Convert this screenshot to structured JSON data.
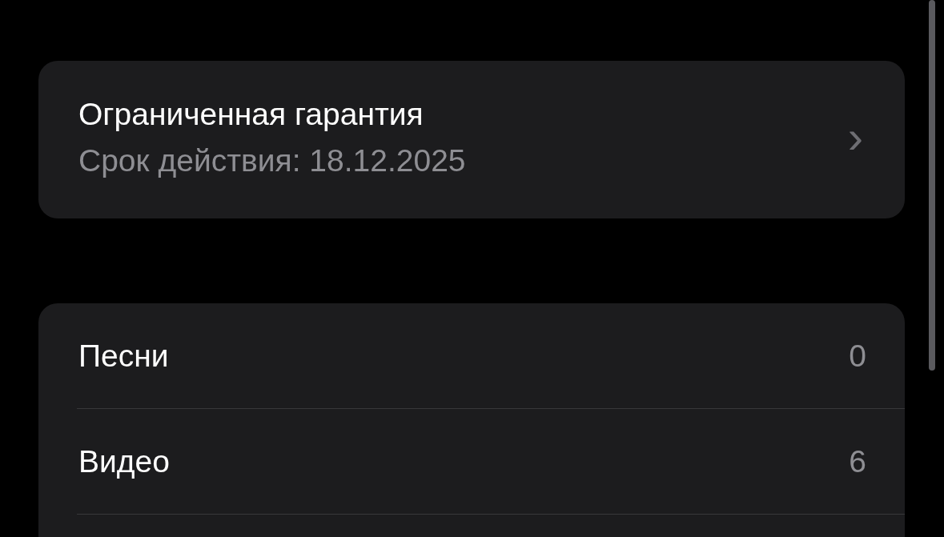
{
  "warranty": {
    "title": "Ограниченная гарантия",
    "subtitle": "Срок действия: 18.12.2025",
    "chevron": "›"
  },
  "counts": [
    {
      "label": "Песни",
      "value": "0"
    },
    {
      "label": "Видео",
      "value": "6"
    }
  ]
}
